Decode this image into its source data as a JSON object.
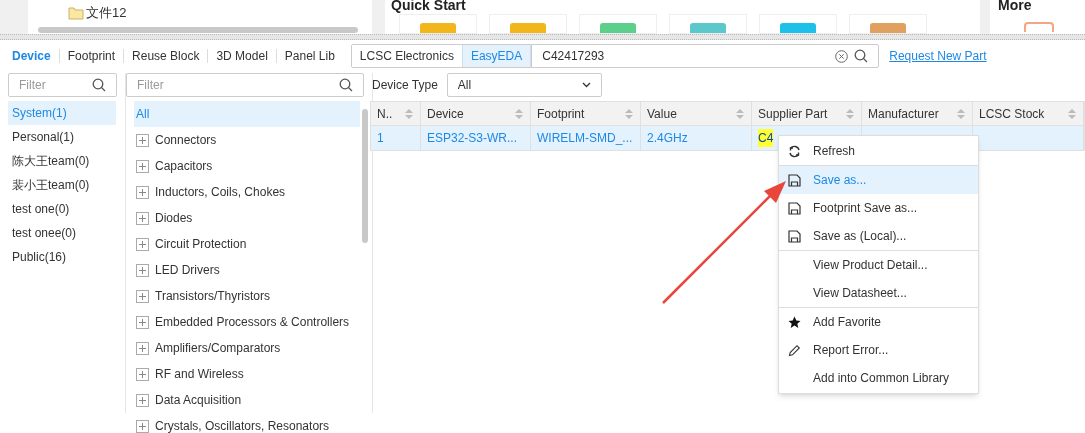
{
  "file_tree": {
    "items": [
      "文件12"
    ]
  },
  "quick_start": {
    "title": "Quick Start",
    "cards": [
      {
        "color": "#f2b61b"
      },
      {
        "color": "#f2b61b"
      },
      {
        "color": "#5ccf8a"
      },
      {
        "color": "#5cc8cc"
      },
      {
        "color": "#1cc0e8"
      },
      {
        "color": "#e0a060"
      }
    ]
  },
  "more": {
    "title": "More"
  },
  "tabs": [
    {
      "label": "Device",
      "selected": true
    },
    {
      "label": "Footprint",
      "selected": false
    },
    {
      "label": "Reuse Block",
      "selected": false
    },
    {
      "label": "3D Model",
      "selected": false
    },
    {
      "label": "Panel Lib",
      "selected": false
    }
  ],
  "source_toggle": [
    {
      "label": "LCSC Electronics",
      "selected": false
    },
    {
      "label": "EasyEDA",
      "selected": true
    }
  ],
  "search": {
    "value": "C42417293"
  },
  "request_link": "Request New Part",
  "library_filter": {
    "placeholder": "Filter"
  },
  "category_filter": {
    "placeholder": "Filter"
  },
  "device_type": {
    "label": "Device Type",
    "value": "All"
  },
  "libraries": [
    {
      "label": "System(1)",
      "selected": true
    },
    {
      "label": "Personal(1)",
      "selected": false
    },
    {
      "label": "陈大王team(0)",
      "selected": false
    },
    {
      "label": "裴小王team(0)",
      "selected": false
    },
    {
      "label": "test one(0)",
      "selected": false
    },
    {
      "label": "test onee(0)",
      "selected": false
    },
    {
      "label": "Public(16)",
      "selected": false
    }
  ],
  "categories": [
    {
      "label": "All",
      "kind": "all",
      "selected": true
    },
    {
      "label": "Connectors",
      "kind": "group",
      "selected": false
    },
    {
      "label": "Capacitors",
      "kind": "group",
      "selected": false
    },
    {
      "label": "Inductors, Coils, Chokes",
      "kind": "group",
      "selected": false
    },
    {
      "label": "Diodes",
      "kind": "group",
      "selected": false
    },
    {
      "label": "Circuit Protection",
      "kind": "group",
      "selected": false
    },
    {
      "label": "LED Drivers",
      "kind": "group",
      "selected": false
    },
    {
      "label": "Transistors/Thyristors",
      "kind": "group",
      "selected": false
    },
    {
      "label": "Embedded Processors & Controllers",
      "kind": "group",
      "selected": false
    },
    {
      "label": "Amplifiers/Comparators",
      "kind": "group",
      "selected": false
    },
    {
      "label": "RF and Wireless",
      "kind": "group",
      "selected": false
    },
    {
      "label": "Data Acquisition",
      "kind": "group",
      "selected": false
    },
    {
      "label": "Crystals, Oscillators, Resonators",
      "kind": "group",
      "selected": false
    }
  ],
  "table": {
    "columns": [
      "N..",
      "Device",
      "Footprint",
      "Value",
      "Supplier Part",
      "Manufacturer",
      "LCSC Stock"
    ],
    "rows": [
      {
        "selected": true,
        "cells": [
          "1",
          "ESP32-S3-WR...",
          "WIRELM-SMD_...",
          "2.4GHz",
          "C4",
          "",
          ""
        ]
      }
    ]
  },
  "context_menu": {
    "sections": [
      [
        {
          "label": "Refresh",
          "kind": "refresh",
          "selected": false
        }
      ],
      [
        {
          "label": "Save as...",
          "kind": "save",
          "selected": true
        },
        {
          "label": "Footprint Save as...",
          "kind": "save",
          "selected": false
        },
        {
          "label": "Save as (Local)...",
          "kind": "save",
          "selected": false
        }
      ],
      [
        {
          "label": "View Product Detail...",
          "kind": "plain",
          "selected": false
        },
        {
          "label": "View Datasheet...",
          "kind": "plain",
          "selected": false
        }
      ],
      [
        {
          "label": "Add Favorite",
          "kind": "star",
          "selected": false
        },
        {
          "label": "Report Error...",
          "kind": "pencil",
          "selected": false
        },
        {
          "label": "Add into Common Library",
          "kind": "plain",
          "selected": false
        }
      ]
    ]
  }
}
